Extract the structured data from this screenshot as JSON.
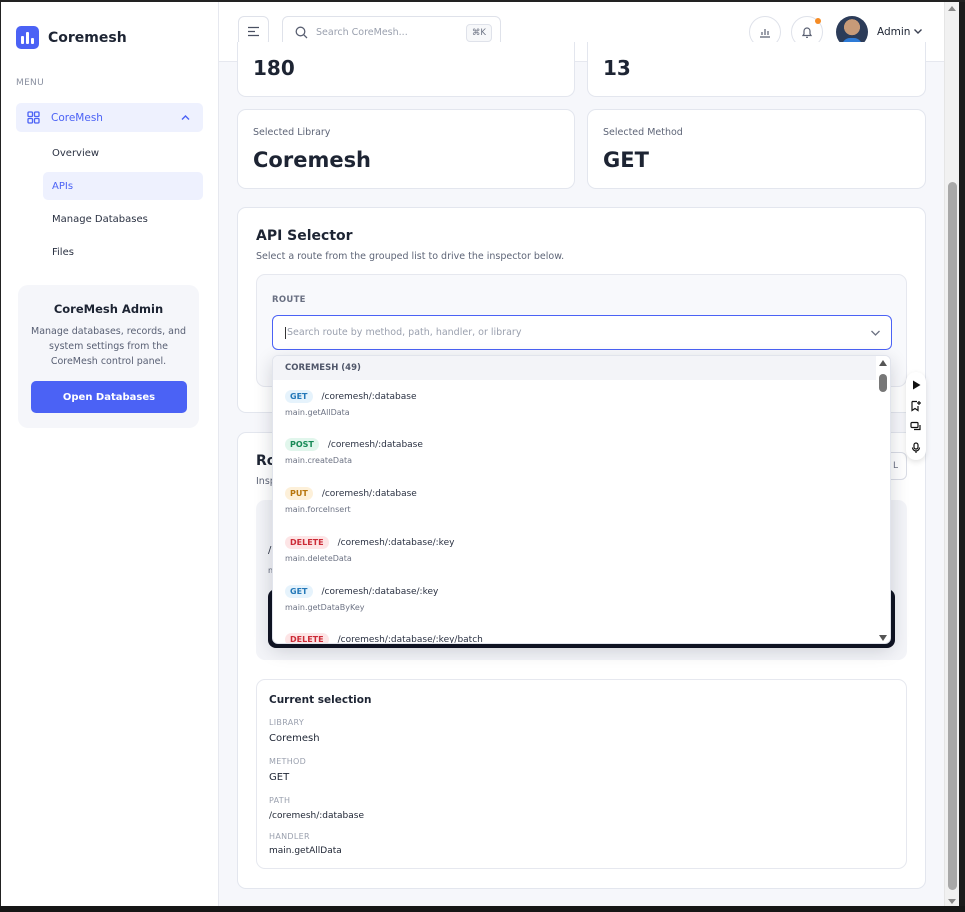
{
  "brand": {
    "name": "Coremesh",
    "accent": "#4b62f5"
  },
  "sidebar": {
    "menu_label": "MENU",
    "parent": {
      "label": "CoreMesh"
    },
    "items": [
      {
        "label": "Overview"
      },
      {
        "label": "APIs"
      },
      {
        "label": "Manage Databases"
      },
      {
        "label": "Files"
      }
    ],
    "admin_card": {
      "title": "CoreMesh Admin",
      "description": "Manage databases, records, and system settings from the CoreMesh control panel.",
      "button": "Open Databases"
    }
  },
  "header": {
    "search_placeholder": "Search CoreMesh...",
    "shortcut": "⌘K",
    "user": "Admin"
  },
  "stats": {
    "top_left_value": "180",
    "top_right_value": "13",
    "library_label": "Selected Library",
    "library_value": "Coremesh",
    "method_label": "Selected Method",
    "method_value": "GET"
  },
  "api_selector": {
    "title": "API Selector",
    "description": "Select a route from the grouped list to drive the inspector below.",
    "route_label": "ROUTE",
    "route_placeholder": "Search route by method, path, handler, or library"
  },
  "dropdown": {
    "group": "COREMESH (49)",
    "options": [
      {
        "method": "GET",
        "path": "/coremesh/:database",
        "handler": "main.getAllData"
      },
      {
        "method": "POST",
        "path": "/coremesh/:database",
        "handler": "main.createData"
      },
      {
        "method": "PUT",
        "path": "/coremesh/:database",
        "handler": "main.forceInsert"
      },
      {
        "method": "DELETE",
        "path": "/coremesh/:database/:key",
        "handler": "main.deleteData"
      },
      {
        "method": "GET",
        "path": "/coremesh/:database/:key",
        "handler": "main.getDataByKey"
      },
      {
        "method": "DELETE",
        "path": "/coremesh/:database/:key/batch",
        "handler": ""
      }
    ]
  },
  "inspector": {
    "title_partial": "Ro",
    "desc_partial": "Insp",
    "button_partial": "L",
    "line1_partial": "/",
    "line2_partial": "n"
  },
  "current_selection": {
    "title": "Current selection",
    "library_label": "LIBRARY",
    "library_value": "Coremesh",
    "method_label": "METHOD",
    "method_value": "GET",
    "path_label": "PATH",
    "path_value": "/coremesh/:database",
    "handler_label": "HANDLER",
    "handler_value": "main.getAllData"
  }
}
